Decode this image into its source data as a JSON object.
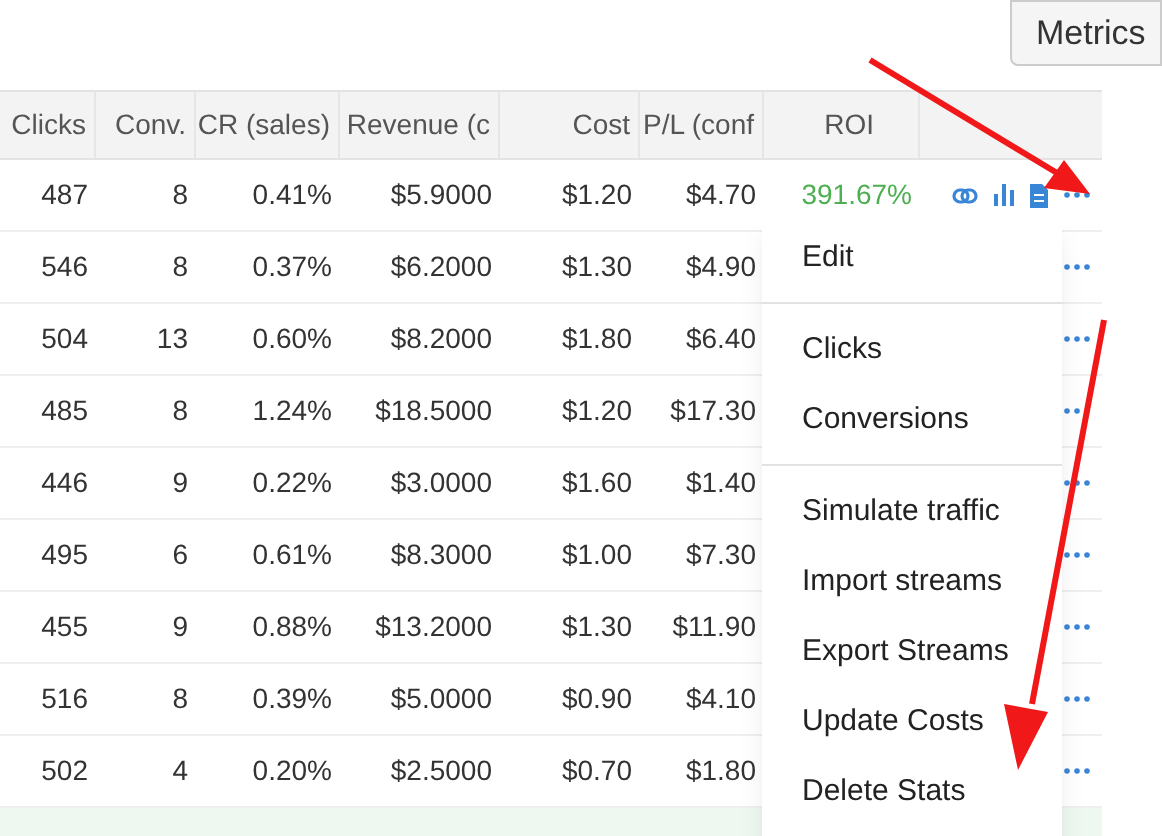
{
  "toolbar": {
    "metrics_button": "Metrics"
  },
  "table": {
    "columns": [
      "Clicks",
      "Conv.",
      "CR (sales)",
      "Revenue (c",
      "Cost",
      "P/L (conf",
      "ROI"
    ],
    "rows": [
      {
        "cells": [
          "487",
          "8",
          "0.41%",
          "$5.9000",
          "$1.20",
          "$4.70",
          "391.67%"
        ],
        "actions": [
          {
            "kind": "link"
          },
          {
            "kind": "chart"
          },
          {
            "kind": "document"
          },
          {
            "kind": "more"
          }
        ],
        "highlighted": false
      },
      {
        "cells": [
          "546",
          "8",
          "0.37%",
          "$6.2000",
          "$1.30",
          "$4.90"
        ],
        "actions": [
          {
            "kind": "more"
          }
        ],
        "highlighted": false
      },
      {
        "cells": [
          "504",
          "13",
          "0.60%",
          "$8.2000",
          "$1.80",
          "$6.40"
        ],
        "actions": [
          {
            "kind": "more"
          }
        ],
        "highlighted": false
      },
      {
        "cells": [
          "485",
          "8",
          "1.24%",
          "$18.5000",
          "$1.20",
          "$17.30"
        ],
        "actions": [
          {
            "kind": "more"
          }
        ],
        "highlighted": false
      },
      {
        "cells": [
          "446",
          "9",
          "0.22%",
          "$3.0000",
          "$1.60",
          "$1.40"
        ],
        "actions": [
          {
            "kind": "more"
          }
        ],
        "highlighted": false
      },
      {
        "cells": [
          "495",
          "6",
          "0.61%",
          "$8.3000",
          "$1.00",
          "$7.30"
        ],
        "actions": [
          {
            "kind": "more"
          }
        ],
        "highlighted": false
      },
      {
        "cells": [
          "455",
          "9",
          "0.88%",
          "$13.2000",
          "$1.30",
          "$11.90"
        ],
        "actions": [
          {
            "kind": "more"
          }
        ],
        "highlighted": false
      },
      {
        "cells": [
          "516",
          "8",
          "0.39%",
          "$5.0000",
          "$0.90",
          "$4.10"
        ],
        "actions": [
          {
            "kind": "more"
          }
        ],
        "highlighted": false
      },
      {
        "cells": [
          "502",
          "4",
          "0.20%",
          "$2.5000",
          "$0.70",
          "$1.80"
        ],
        "actions": [
          {
            "kind": "more"
          }
        ],
        "highlighted": false
      },
      {
        "cells": [],
        "actions": [],
        "highlighted": true
      }
    ]
  },
  "context_menu": {
    "groups": [
      [
        "Edit"
      ],
      [
        "Clicks",
        "Conversions"
      ],
      [
        "Simulate traffic",
        "Import streams",
        "Export Streams",
        "Update Costs",
        "Delete Stats"
      ]
    ]
  }
}
